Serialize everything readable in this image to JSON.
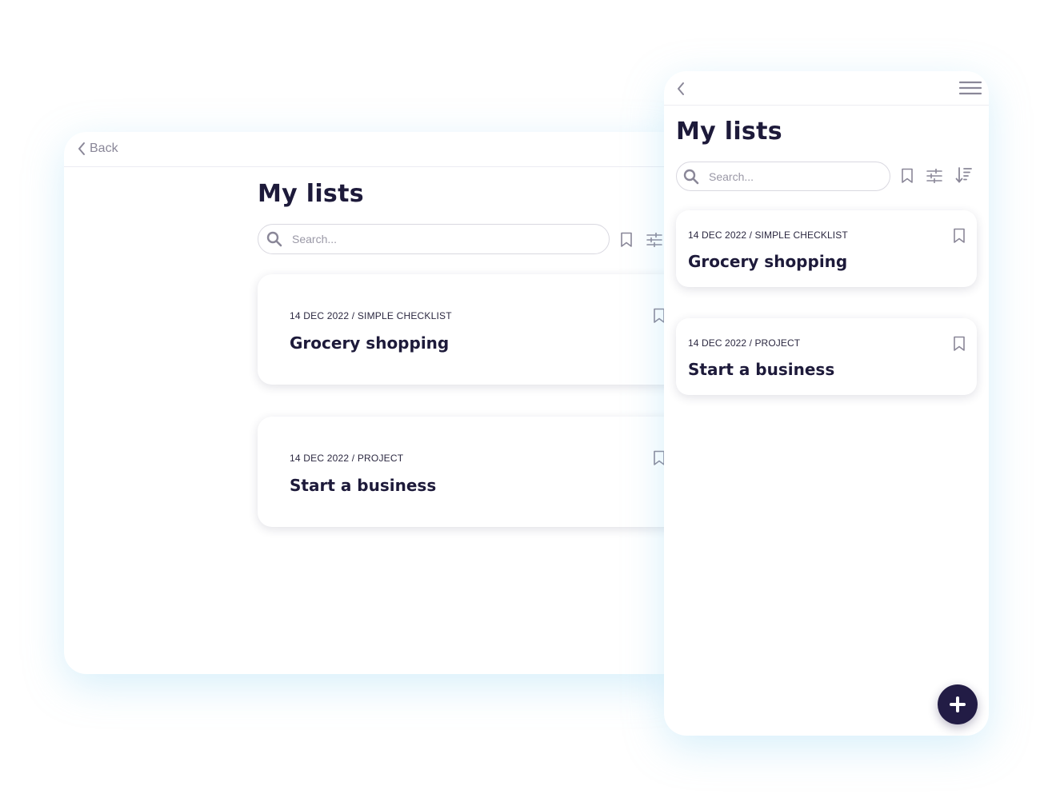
{
  "desktop": {
    "back_label": "Back",
    "title": "My lists",
    "search": {
      "placeholder": "Search..."
    },
    "cards": [
      {
        "meta": "14 DEC 2022 / SIMPLE CHECKLIST",
        "name": "Grocery shopping"
      },
      {
        "meta": "14 DEC 2022 / PROJECT",
        "name": "Start a business"
      }
    ]
  },
  "mobile": {
    "title": "My lists",
    "search": {
      "placeholder": "Search..."
    },
    "cards": [
      {
        "meta": "14 DEC 2022 / SIMPLE CHECKLIST",
        "name": "Grocery shopping"
      },
      {
        "meta": "14 DEC 2022 / PROJECT",
        "name": "Start a business"
      }
    ],
    "fab_icon": "plus-icon"
  },
  "colors": {
    "primary_dark": "#221c45",
    "text_dark": "#1d1a3a",
    "icon_gray": "#8a8798",
    "border": "#d9d8e0",
    "glow": "#8cd2f0"
  }
}
